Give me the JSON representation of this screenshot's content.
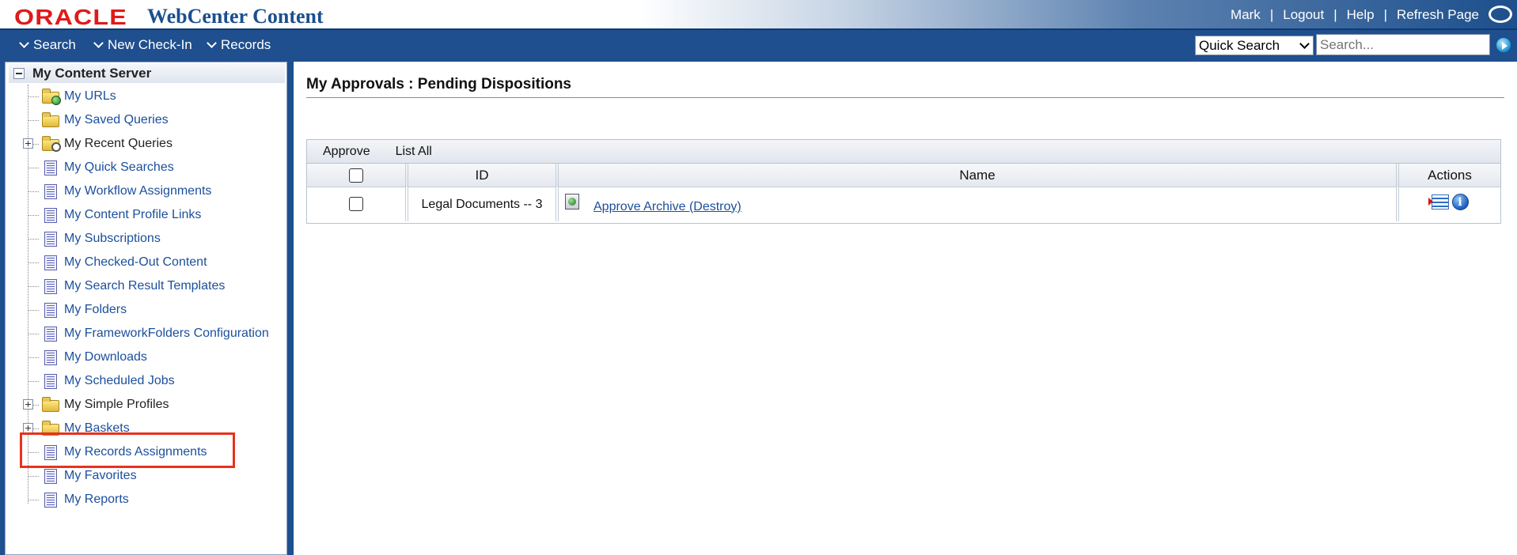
{
  "header": {
    "brand": "ORACLE",
    "product": "WebCenter Content",
    "links": [
      "Mark",
      "Logout",
      "Help",
      "Refresh Page"
    ]
  },
  "menu": {
    "items": [
      "Search",
      "New Check-In",
      "Records"
    ],
    "quick_search_selected": "Quick Search",
    "search_placeholder": "Search..."
  },
  "sidebar": {
    "root": "My Content Server",
    "items": [
      {
        "label": "My URLs",
        "icon": "folder-globe-icon",
        "expandable": false
      },
      {
        "label": "My Saved Queries",
        "icon": "folder-icon",
        "expandable": false
      },
      {
        "label": "My Recent Queries",
        "icon": "folder-search-icon",
        "expandable": true
      },
      {
        "label": "My Quick Searches",
        "icon": "page-icon",
        "expandable": false
      },
      {
        "label": "My Workflow Assignments",
        "icon": "page-icon",
        "expandable": false
      },
      {
        "label": "My Content Profile Links",
        "icon": "page-icon",
        "expandable": false
      },
      {
        "label": "My Subscriptions",
        "icon": "page-icon",
        "expandable": false
      },
      {
        "label": "My Checked-Out Content",
        "icon": "page-icon",
        "expandable": false
      },
      {
        "label": "My Search Result Templates",
        "icon": "page-icon",
        "expandable": false
      },
      {
        "label": "My Folders",
        "icon": "page-icon",
        "expandable": false
      },
      {
        "label": "My FrameworkFolders Configuration",
        "icon": "page-icon",
        "expandable": false
      },
      {
        "label": "My Downloads",
        "icon": "page-icon",
        "expandable": false
      },
      {
        "label": "My Scheduled Jobs",
        "icon": "page-icon",
        "expandable": false
      },
      {
        "label": "My Simple Profiles",
        "icon": "folder-icon",
        "expandable": true
      },
      {
        "label": "My Baskets",
        "icon": "folder-icon",
        "expandable": true
      },
      {
        "label": "My Records Assignments",
        "icon": "page-icon",
        "expandable": false
      },
      {
        "label": "My Favorites",
        "icon": "page-icon",
        "expandable": false
      },
      {
        "label": "My Reports",
        "icon": "page-icon",
        "expandable": false
      }
    ]
  },
  "main": {
    "title": "My Approvals : Pending Dispositions",
    "toolbar": [
      "Approve",
      "List All"
    ],
    "columns": [
      "ID",
      "Name",
      "Actions"
    ],
    "rows": [
      {
        "id": "Legal Documents -- 3",
        "name": "Approve Archive (Destroy)"
      }
    ]
  },
  "colors": {
    "brand_red": "#e01a1a",
    "nav_blue": "#1f4f8e",
    "link_blue": "#1b4f9c",
    "highlight": "#e8321d"
  }
}
